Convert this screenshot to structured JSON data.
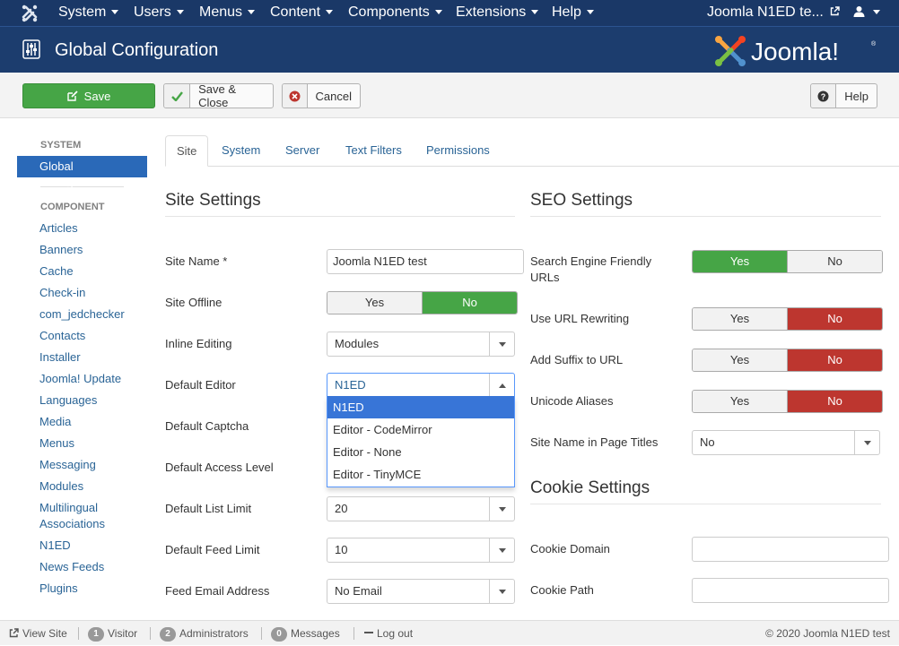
{
  "topnav": {
    "menus": [
      "System",
      "Users",
      "Menus",
      "Content",
      "Components",
      "Extensions",
      "Help"
    ],
    "site_link": "Joomla N1ED te...",
    "user_icon": "user-icon"
  },
  "header": {
    "title": "Global Configuration",
    "logo_text": "Joomla!",
    "reg": "®"
  },
  "toolbar": {
    "save": "Save",
    "save_close": "Save & Close",
    "cancel": "Cancel",
    "help": "Help"
  },
  "sidebar": {
    "system_heading": "System",
    "active": "Global Configuration",
    "component_heading": "Component",
    "items": [
      "Articles",
      "Banners",
      "Cache",
      "Check-in",
      "com_jedchecker",
      "Contacts",
      "Installer",
      "Joomla! Update",
      "Languages",
      "Media",
      "Menus",
      "Messaging",
      "Modules",
      "Multilingual Associations",
      "N1ED",
      "News Feeds",
      "Plugins"
    ]
  },
  "tabs": [
    "Site",
    "System",
    "Server",
    "Text Filters",
    "Permissions"
  ],
  "site_settings": {
    "title": "Site Settings",
    "site_name_label": "Site Name *",
    "site_name_value": "Joomla N1ED test",
    "site_offline_label": "Site Offline",
    "yes": "Yes",
    "no": "No",
    "inline_editing_label": "Inline Editing",
    "inline_editing_value": "Modules",
    "default_editor_label": "Default Editor",
    "default_editor_value": "N1ED",
    "default_captcha_label": "Default Captcha",
    "default_access_label": "Default Access Level",
    "list_limit_label": "Default List Limit",
    "list_limit_value": "20",
    "feed_limit_label": "Default Feed Limit",
    "feed_limit_value": "10",
    "feed_email_label": "Feed Email Address",
    "feed_email_value": "No Email"
  },
  "editor_options": [
    "N1ED",
    "Editor - CodeMirror",
    "Editor - None",
    "Editor - TinyMCE"
  ],
  "seo_settings": {
    "title": "SEO Settings",
    "sef_label": "Search Engine Friendly URLs",
    "rewrite_label": "Use URL Rewriting",
    "suffix_label": "Add Suffix to URL",
    "unicode_label": "Unicode Aliases",
    "sitename_titles_label": "Site Name in Page Titles",
    "sitename_titles_value": "No"
  },
  "cookie_settings": {
    "title": "Cookie Settings",
    "domain_label": "Cookie Domain",
    "path_label": "Cookie Path"
  },
  "statusbar": {
    "view_site": "View Site",
    "visitors_count": "1",
    "visitors_label": "Visitor",
    "admins_count": "2",
    "admins_label": "Administrators",
    "messages_count": "0",
    "messages_label": "Messages",
    "logout": "Log out",
    "copyright": "© 2020 Joomla N1ED test"
  },
  "colors": {
    "nav_bg": "#1a3867",
    "save_green": "#46a546",
    "toggle_red": "#bd362f",
    "link_blue": "#2a6496",
    "active_blue": "#2a69b8"
  }
}
